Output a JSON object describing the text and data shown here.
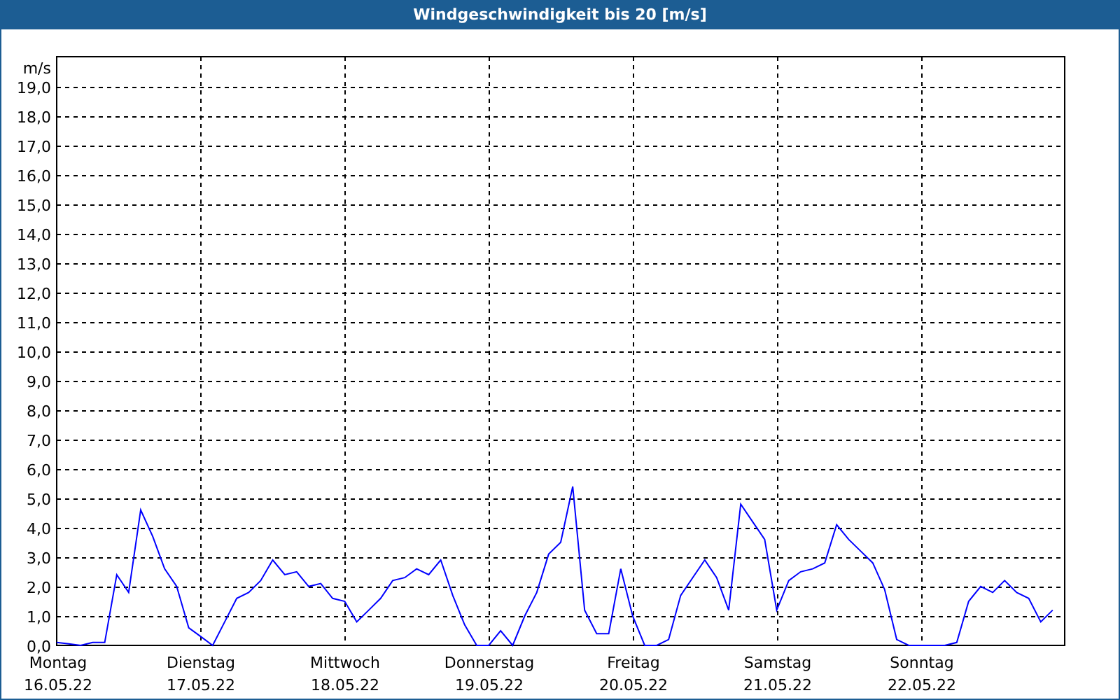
{
  "window": {
    "title": "Windgeschwindigkeit bis 20 [m/s]"
  },
  "chart": {
    "chart_data": {
      "type": "line",
      "grid": true,
      "ylabel": "m/s",
      "ylim": [
        0,
        20
      ],
      "categories": [
        "Montag 16.05.22",
        null,
        null,
        null,
        null,
        null,
        null,
        null,
        null,
        null,
        null,
        null,
        "Dienstag 17.05.22",
        null,
        null,
        null,
        null,
        null,
        null,
        null,
        null,
        null,
        null,
        null,
        "Mittwoch 18.05.22",
        null,
        null,
        null,
        null,
        null,
        null,
        null,
        null,
        null,
        null,
        null,
        "Donnerstag 19.05.22",
        null,
        null,
        null,
        null,
        null,
        null,
        null,
        null,
        null,
        null,
        null,
        "Freitag 20.05.22",
        null,
        null,
        null,
        null,
        null,
        null,
        null,
        null,
        null,
        null,
        null,
        "Samstag 21.05.22",
        null,
        null,
        null,
        null,
        null,
        null,
        null,
        null,
        null,
        null,
        null,
        "Sonntag 22.05.22",
        null,
        null,
        null,
        null,
        null,
        null,
        null,
        null,
        null,
        null,
        null
      ],
      "series": [
        {
          "color": "#0000ff",
          "values": [
            0.1,
            0.05,
            0,
            0.1,
            0.1,
            2.4,
            1.8,
            4.6,
            3.7,
            2.6,
            2,
            0.6,
            0.3,
            0,
            0.8,
            1.6,
            1.8,
            2.2,
            2.9,
            2.4,
            2.5,
            2,
            2.1,
            1.6,
            1.5,
            0.8,
            1.2,
            1.6,
            2.2,
            2.3,
            2.6,
            2.4,
            2.9,
            1.7,
            0.7,
            0,
            0,
            0.5,
            0,
            1,
            1.8,
            3.1,
            3.5,
            5.4,
            1.2,
            0.4,
            0.4,
            2.6,
            1,
            0,
            0,
            0.2,
            1.7,
            2.3,
            2.9,
            2.3,
            1.2,
            4.8,
            4.2,
            3.6,
            1.2,
            2.2,
            2.5,
            2.6,
            2.8,
            4.1,
            3.6,
            3.2,
            2.8,
            1.9,
            0.2,
            0,
            0,
            0,
            0,
            0.1,
            1.5,
            2,
            1.8,
            2.2,
            1.8,
            1.6,
            0.8,
            1.2
          ]
        }
      ],
      "yticks": [
        {
          "value": 0,
          "label": "0,0"
        },
        {
          "value": 1,
          "label": "1,0"
        },
        {
          "value": 2,
          "label": "2,0"
        },
        {
          "value": 3,
          "label": "3,0"
        },
        {
          "value": 4,
          "label": "4,0"
        },
        {
          "value": 5,
          "label": "5,0"
        },
        {
          "value": 6,
          "label": "6,0"
        },
        {
          "value": 7,
          "label": "7,0"
        },
        {
          "value": 8,
          "label": "8,0"
        },
        {
          "value": 9,
          "label": "9,0"
        },
        {
          "value": 10,
          "label": "10,0"
        },
        {
          "value": 11,
          "label": "11,0"
        },
        {
          "value": 12,
          "label": "12,0"
        },
        {
          "value": 13,
          "label": "13,0"
        },
        {
          "value": 14,
          "label": "14,0"
        },
        {
          "value": 15,
          "label": "15,0"
        },
        {
          "value": 16,
          "label": "16,0"
        },
        {
          "value": 17,
          "label": "17,0"
        },
        {
          "value": 18,
          "label": "18,0"
        },
        {
          "value": 19,
          "label": "19,0"
        }
      ]
    }
  }
}
